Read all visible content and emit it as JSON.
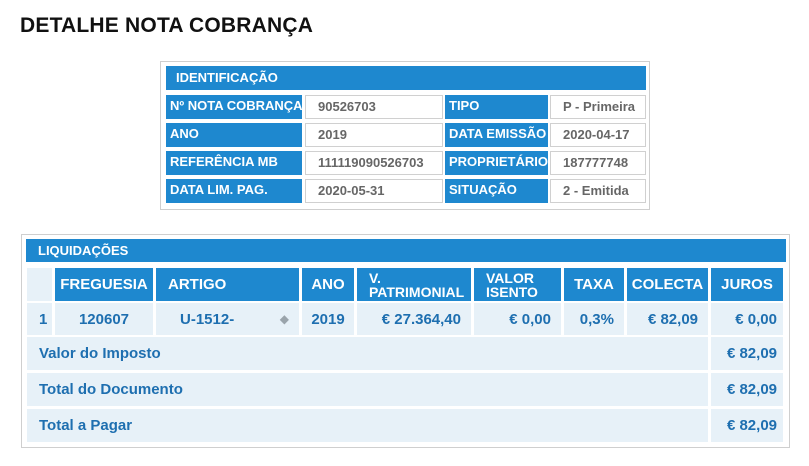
{
  "page": {
    "title": "DETALHE NOTA COBRANÇA"
  },
  "identificacao": {
    "header": "IDENTIFICAÇÃO",
    "fields": {
      "nota_label": "Nº NOTA COBRANÇA",
      "nota_value": "90526703",
      "tipo_label": "TIPO",
      "tipo_value": "P - Primeira",
      "ano_label": "ANO",
      "ano_value": "2019",
      "data_emissao_label": "DATA EMISSÃO",
      "data_emissao_value": "2020-04-17",
      "referencia_label": "REFERÊNCIA MB",
      "referencia_value": "111119090526703",
      "proprietario_label": "PROPRIETÁRIO",
      "proprietario_value": "187777748",
      "data_lim_label": "DATA LIM. PAG.",
      "data_lim_value": "2020-05-31",
      "situacao_label": "SITUAÇÃO",
      "situacao_value": "2 - Emitida"
    }
  },
  "liquidacoes": {
    "header": "LIQUIDAÇÕES",
    "columns": {
      "freguesia": "FREGUESIA",
      "artigo": "ARTIGO",
      "ano": "ANO",
      "v_patrimonial_1": "V.",
      "v_patrimonial_2": "PATRIMONIAL",
      "valor_isento_1": "VALOR",
      "valor_isento_2": "ISENTO",
      "taxa": "TAXA",
      "colecta": "COLECTA",
      "juros": "JUROS"
    },
    "row": {
      "num": "1",
      "freguesia": "120607",
      "artigo": "U-1512-",
      "ano": "2019",
      "v_patrimonial": "€ 27.364,40",
      "valor_isento": "€ 0,00",
      "taxa": "0,3%",
      "colecta": "€ 82,09",
      "juros": "€ 0,00"
    },
    "summary": {
      "valor_imposto_label": "Valor do Imposto",
      "valor_imposto_value": "€ 82,09",
      "total_documento_label": "Total do Documento",
      "total_documento_value": "€ 82,09",
      "total_pagar_label": "Total a Pagar",
      "total_pagar_value": "€ 82,09"
    }
  },
  "icons": {
    "artigo_action": "attachment-icon"
  },
  "colors": {
    "header_blue": "#1e88cf",
    "row_bg": "#e7f1f8",
    "value_text": "#1e6fb0"
  }
}
